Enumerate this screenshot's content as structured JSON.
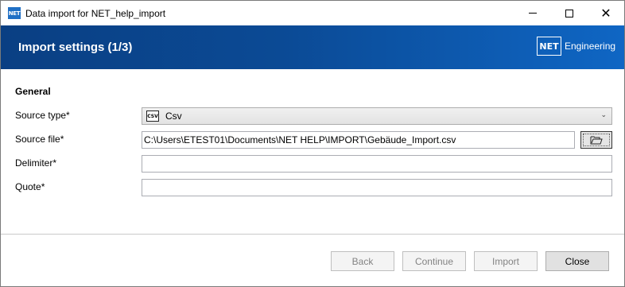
{
  "window": {
    "app_icon": "NET",
    "title": "Data import for NET_help_import",
    "minimize_icon": "minimize-icon",
    "maximize_icon": "maximize-icon",
    "close_glyph": "✕"
  },
  "banner": {
    "title": "Import settings (1/3)",
    "brand_logo": "NET",
    "brand_text": "Engineering",
    "gradient_start": "#0a3f83",
    "gradient_end": "#0f66c4"
  },
  "form": {
    "section_title": "General",
    "source_type": {
      "label": "Source type*",
      "value": "Csv",
      "icon_text": "CSV"
    },
    "source_file": {
      "label": "Source file*",
      "value": "C:\\Users\\ETEST01\\Documents\\NET HELP\\IMPORT\\Gebäude_Import.csv"
    },
    "delimiter": {
      "label": "Delimiter*",
      "value": ""
    },
    "quote": {
      "label": "Quote*",
      "value": ""
    }
  },
  "buttons": {
    "back": "Back",
    "continue": "Continue",
    "import": "Import",
    "close": "Close"
  }
}
